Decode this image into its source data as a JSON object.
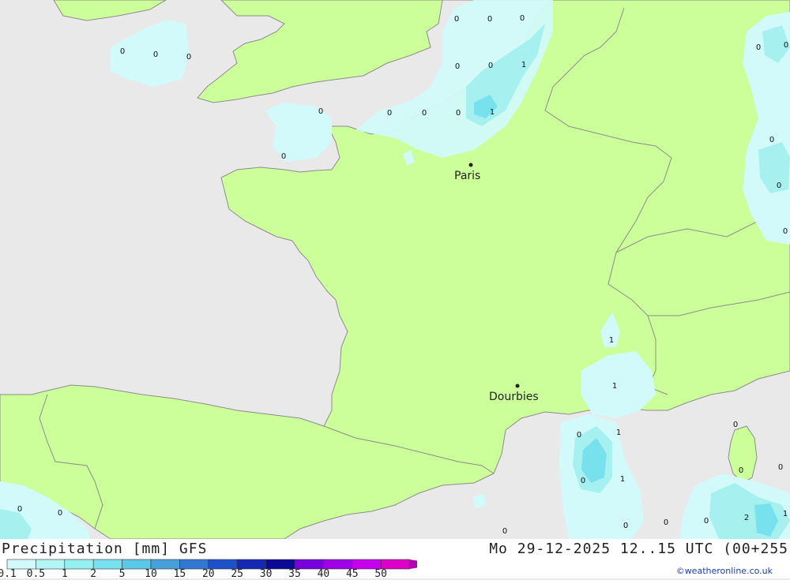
{
  "footer": {
    "title": "Precipitation [mm] GFS",
    "datetime": "Mo 29-12-2025 12..15 UTC (00+255",
    "credit": "©weatheronline.co.uk"
  },
  "legend": {
    "ticks": [
      "0.1",
      "0.5",
      "1",
      "2",
      "5",
      "10",
      "15",
      "20",
      "25",
      "30",
      "35",
      "40",
      "45",
      "50"
    ],
    "colors": [
      "#d2fafa",
      "#b4f5f5",
      "#96f0f0",
      "#78e1f0",
      "#5ac8e6",
      "#46a0dc",
      "#3278d2",
      "#1e50c8",
      "#1428b4",
      "#0a0a96",
      "#7800dc",
      "#a000e6",
      "#c800f0",
      "#dc00c8",
      "#b400b4"
    ]
  },
  "colors": {
    "land": "#ccff99",
    "sea": "#e9e9e9",
    "precip_light": "#d2fafa",
    "precip_mid": "#a6f0f0",
    "precip_strong": "#78e1ee",
    "border": "#8c8c8c"
  },
  "cities": [
    {
      "name": "Paris"
    },
    {
      "name": "Dourbies"
    }
  ],
  "values": [
    "0",
    "0",
    "0",
    "0",
    "0",
    "0",
    "0",
    "0",
    "1",
    "0",
    "0",
    "0",
    "0",
    "1",
    "0",
    "0",
    "0",
    "0",
    "0",
    "1",
    "1",
    "0",
    "1",
    "0",
    "0",
    "1",
    "0",
    "0",
    "0",
    "0",
    "0",
    "0",
    "0",
    "2",
    "1",
    "0",
    "0"
  ]
}
